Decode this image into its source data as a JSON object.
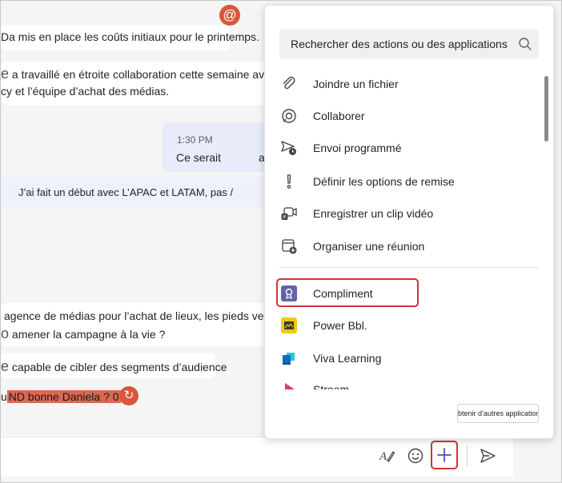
{
  "chat": {
    "messages": [
      {
        "text": "Da mis en place les coûts initiaux pour le printemps."
      },
      {
        "prefix": "e",
        "text": " a travaillé en étroite collaboration cette semaine avec les"
      },
      {
        "text": "cy et l’équipe d’achat des médias."
      },
      {
        "time": "1:30 PM",
        "text": "Ce serait",
        "trail": "a"
      },
      {
        "text": "J’ai fait un début avec L’APAC et LATAM, pas /"
      },
      {
        "text": "agence de médias pour l’achat de lieux, les pieds veer"
      },
      {
        "prefix": "o",
        "text": " amener la campagne à la vie ?"
      },
      {
        "prefix": "e",
        "text": " capable de cibler des segments d’audience"
      },
      {
        "prefix": "u",
        "highlight": "ND bonne Daniela ? 0"
      }
    ]
  },
  "menu": {
    "search_placeholder": "Rechercher des actions ou des applications",
    "actions": [
      {
        "label": "Joindre un fichier",
        "icon": "paperclip-icon"
      },
      {
        "label": "Collaborer",
        "icon": "loop-icon"
      },
      {
        "label": "Envoi programmé",
        "icon": "scheduled-send-icon"
      },
      {
        "label": "Définir les options de remise",
        "icon": "exclamation-icon"
      },
      {
        "label": "Enregistrer un clip vidéo",
        "icon": "video-clip-icon"
      },
      {
        "label": "Organiser une réunion",
        "icon": "calendar-add-icon"
      }
    ],
    "apps": [
      {
        "label": "Compliment",
        "icon": "compliment-icon",
        "color": "#6264a7"
      },
      {
        "label": "Power Bbl.",
        "icon": "power-bi-icon",
        "color": "#f2c811"
      },
      {
        "label": "Viva Learning",
        "icon": "viva-learning-icon",
        "color": "#0f6cbd"
      },
      {
        "label": "Stream",
        "icon": "stream-icon",
        "color": "#e3366a"
      }
    ],
    "more_apps_label": "Obtenir d’autres applications"
  },
  "composer": {
    "buttons": [
      "format-icon",
      "emoji-icon",
      "plus-icon",
      "send-icon"
    ]
  }
}
